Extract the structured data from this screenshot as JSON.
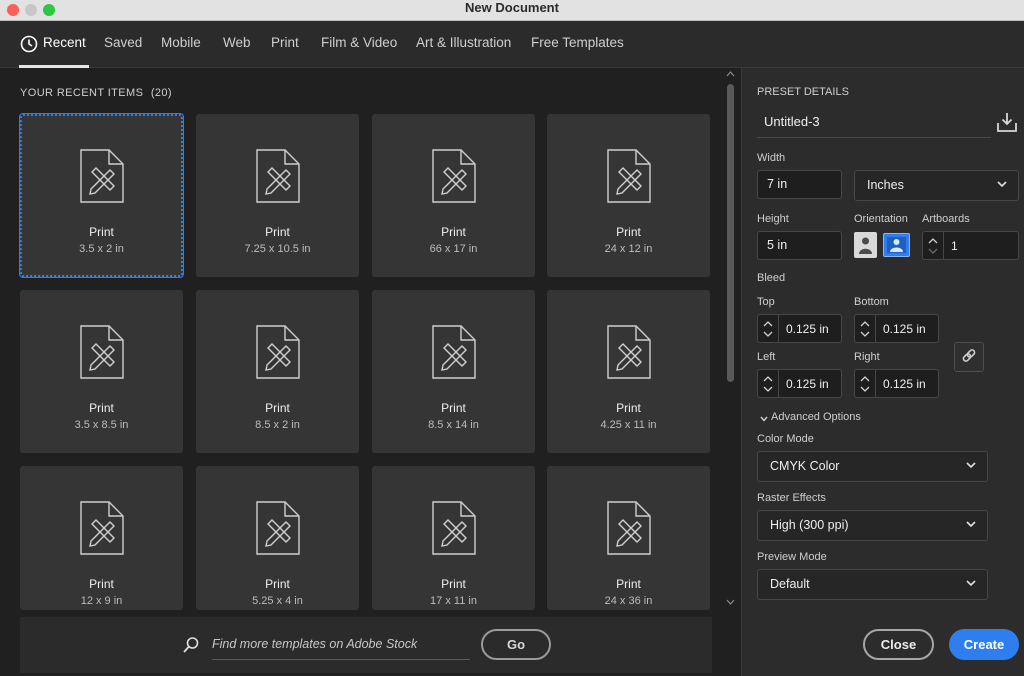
{
  "window": {
    "title": "New Document"
  },
  "tabs": [
    {
      "label": "Recent",
      "icon": "clock-icon",
      "active": true
    },
    {
      "label": "Saved"
    },
    {
      "label": "Mobile"
    },
    {
      "label": "Web"
    },
    {
      "label": "Print"
    },
    {
      "label": "Film & Video"
    },
    {
      "label": "Art & Illustration"
    },
    {
      "label": "Free Templates"
    }
  ],
  "recent": {
    "header": "YOUR RECENT ITEMS",
    "count": "(20)",
    "items": [
      {
        "name": "Print",
        "size": "3.5 x 2 in",
        "selected": true
      },
      {
        "name": "Print",
        "size": "7.25 x 10.5 in"
      },
      {
        "name": "Print",
        "size": "66 x 17 in"
      },
      {
        "name": "Print",
        "size": "24 x 12 in"
      },
      {
        "name": "Print",
        "size": "3.5 x 8.5 in"
      },
      {
        "name": "Print",
        "size": "8.5 x 2 in"
      },
      {
        "name": "Print",
        "size": "8.5 x 14 in"
      },
      {
        "name": "Print",
        "size": "4.25 x 11 in"
      },
      {
        "name": "Print",
        "size": "12 x 9 in"
      },
      {
        "name": "Print",
        "size": "5.25 x 4 in"
      },
      {
        "name": "Print",
        "size": "17 x 11 in"
      },
      {
        "name": "Print",
        "size": "24 x 36 in"
      }
    ]
  },
  "search": {
    "placeholder": "Find more templates on Adobe Stock",
    "go_label": "Go"
  },
  "preset": {
    "section_title": "PRESET DETAILS",
    "name": "Untitled-3",
    "width_label": "Width",
    "width_value": "7 in",
    "units": "Inches",
    "height_label": "Height",
    "height_value": "5 in",
    "orientation_label": "Orientation",
    "artboards_label": "Artboards",
    "artboards_value": "1",
    "bleed_label": "Bleed",
    "bleed": {
      "top_label": "Top",
      "top": "0.125 in",
      "bottom_label": "Bottom",
      "bottom": "0.125 in",
      "left_label": "Left",
      "left": "0.125 in",
      "right_label": "Right",
      "right": "0.125 in"
    },
    "advanced_label": "Advanced Options",
    "color_mode_label": "Color Mode",
    "color_mode": "CMYK Color",
    "raster_label": "Raster Effects",
    "raster": "High (300 ppi)",
    "preview_label": "Preview Mode",
    "preview": "Default"
  },
  "actions": {
    "close": "Close",
    "create": "Create"
  },
  "colors": {
    "accent": "#2f7ef0",
    "card": "#353535",
    "panel": "#2c2c2c"
  }
}
